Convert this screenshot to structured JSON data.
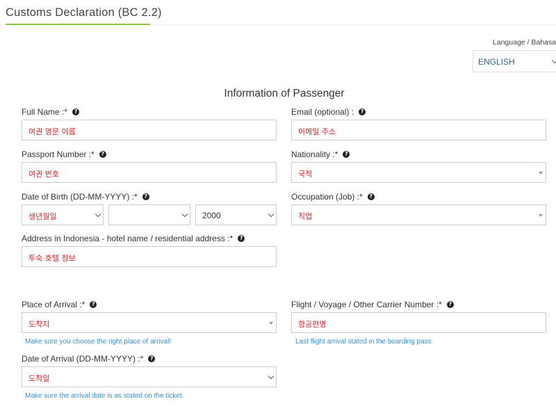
{
  "header": {
    "title": "Customs Declaration (BC 2.2)"
  },
  "language": {
    "label": "Language / Bahasa",
    "selected": "ENGLISH"
  },
  "section": {
    "title": "Information of Passenger"
  },
  "form": {
    "full_name": {
      "label": "Full Name :*",
      "value": "여권 영문 이름"
    },
    "email": {
      "label": "Email (optional) :",
      "value": "이메일 주소"
    },
    "passport": {
      "label": "Passport Number :*",
      "value": "여권 번호"
    },
    "nationality": {
      "label": "Nationality :*",
      "value": "국적"
    },
    "dob": {
      "label": "Date of Birth (DD-MM-YYYY) :*",
      "day": "생년월일",
      "month": "",
      "year": "2000"
    },
    "occupation": {
      "label": "Occupation (Job) :*",
      "value": "직업"
    },
    "address": {
      "label": "Address in Indonesia - hotel name / residential address :*",
      "value": "투숙 호텔 정보"
    },
    "arrival_place": {
      "label": "Place of Arrival :*",
      "value": "도착지",
      "hint": "Make sure you choose the right place of arrival!"
    },
    "flight": {
      "label": "Flight / Voyage / Other Carrier Number :*",
      "value": "항공편명",
      "hint": "Last flight arrival stated in the boarding pass"
    },
    "arrival_date": {
      "label": "Date of Arrival (DD-MM-YYYY) :*",
      "value": "도착일",
      "hint": "Make sure the arrival date is as stated on the ticket."
    }
  }
}
